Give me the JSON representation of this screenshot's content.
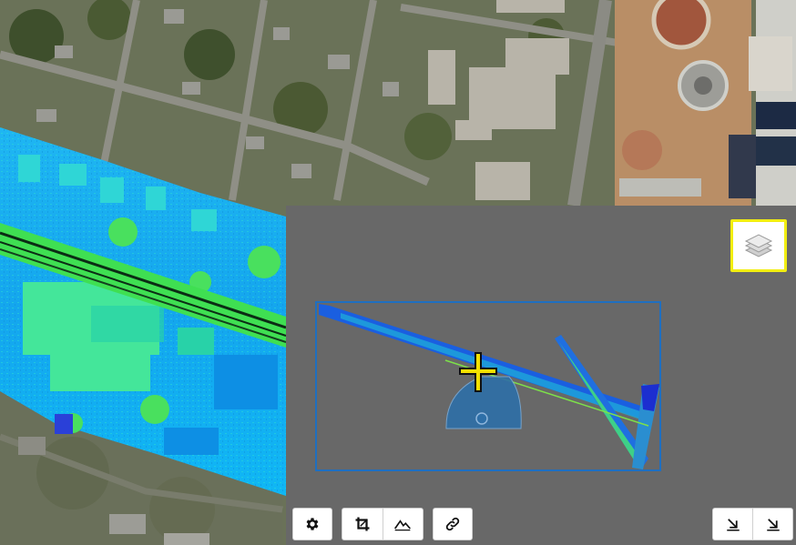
{
  "viewer": {
    "mode": "aerial-basemap-with-lidar-overlay",
    "colors": {
      "overview_panel": "#686868",
      "extent_frame": "#1f6fc0",
      "crosshair": "#f5e000",
      "camera_cone": "#2e6fa8",
      "highlight": "#f2ee11",
      "point_low": "#1a3fd8",
      "point_mid": "#20b8ff",
      "point_high": "#2ee86a"
    }
  },
  "layers_button": {
    "icon": "layers-icon",
    "highlighted": true
  },
  "toolbar_left": [
    {
      "name": "settings-button",
      "icon": "gear-icon"
    },
    {
      "name": "crop-button",
      "icon": "crop-icon"
    },
    {
      "name": "profile-button",
      "icon": "elevation-profile-icon"
    },
    {
      "name": "link-button",
      "icon": "link-icon"
    }
  ],
  "toolbar_right": [
    {
      "name": "collapse-button",
      "icon": "arrow-down-right-icon"
    },
    {
      "name": "expand-button",
      "icon": "arrow-down-right-icon"
    }
  ]
}
